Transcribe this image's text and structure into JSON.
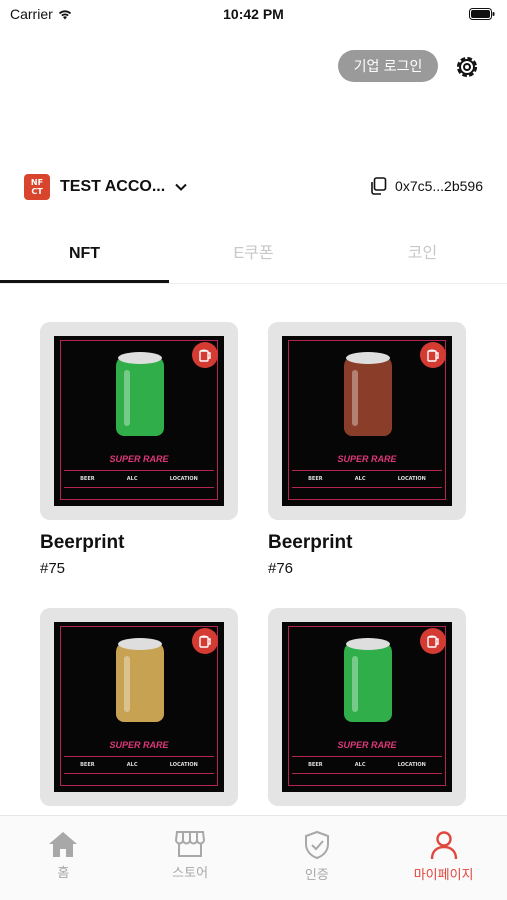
{
  "status_bar": {
    "carrier": "Carrier",
    "time": "10:42 PM"
  },
  "header": {
    "corp_login": "기업 로그인"
  },
  "account": {
    "logo_text": [
      "NF",
      "CT"
    ],
    "name": "TEST ACCO...",
    "wallet": "0x7c5...2b596"
  },
  "tabs": [
    {
      "label": "NFT",
      "active": true
    },
    {
      "label": "E쿠폰",
      "active": false
    },
    {
      "label": "코인",
      "active": false
    }
  ],
  "cards": [
    {
      "title": "Beerprint",
      "sub": "#75",
      "rarity": "SUPER RARE",
      "can_color": "#2fae4a",
      "info": [
        "BEER",
        "ALC",
        "LOCATION"
      ]
    },
    {
      "title": "Beerprint",
      "sub": "#76",
      "rarity": "SUPER RARE",
      "can_color": "#8a3e2a",
      "info": [
        "BEER",
        "ALC",
        "LOCATION"
      ]
    },
    {
      "title": "",
      "sub": "",
      "rarity": "SUPER RARE",
      "can_color": "#c8a253",
      "info": [
        "BEER",
        "ALC",
        "LOCATION"
      ]
    },
    {
      "title": "",
      "sub": "",
      "rarity": "SUPER RARE",
      "can_color": "#2fae4a",
      "info": [
        "BEER",
        "ALC",
        "LOCATION"
      ]
    }
  ],
  "nav": [
    {
      "label": "홈",
      "icon": "home-icon",
      "active": false
    },
    {
      "label": "스토어",
      "icon": "store-icon",
      "active": false
    },
    {
      "label": "인증",
      "icon": "shield-check-icon",
      "active": false
    },
    {
      "label": "마이페이지",
      "icon": "person-icon",
      "active": true
    }
  ],
  "colors": {
    "accent": "#e0483e",
    "rarity": "#e0387a"
  }
}
